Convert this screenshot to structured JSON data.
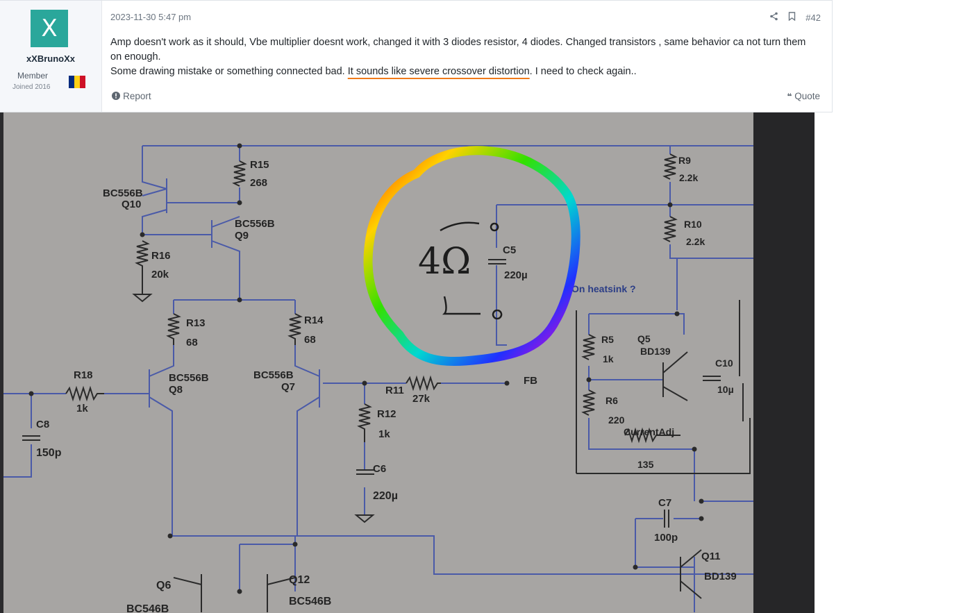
{
  "post": {
    "user": {
      "avatar_letter": "X",
      "name": "xXBrunoXx",
      "role": "Member",
      "joined": "Joined 2016",
      "flag_colors": [
        "#002b7f",
        "#fcd116",
        "#ce1126"
      ],
      "avatar_color": "#2aa79b"
    },
    "date": "2023-11-30 5:47 pm",
    "post_number": "#42",
    "icons": {
      "share": "share-icon",
      "bookmark": "bookmark-icon",
      "report": "alert-icon",
      "quote": "quote-icon"
    },
    "text": {
      "line1": "Amp doesn't work as it should, Vbe multiplier doesnt work, changed it with 3 diodes resistor, 4 diodes. Changed transistors , same behavior ca not turn them on enough.",
      "line2_before": "Some drawing mistake or something connected bad. ",
      "line2_highlight": "It sounds like severe crossover distortion",
      "line2_after": ". I need to check again.."
    },
    "report_label": "Report",
    "quote_label": "Quote",
    "highlight_color": "#f07a1a"
  },
  "schematic": {
    "labels": {
      "q10_type": "BC556B",
      "q10": "Q10",
      "r15": "R15",
      "r15_val": "268",
      "q9_type": "BC556B",
      "q9": "Q9",
      "r16": "R16",
      "r16_val": "20k",
      "r13": "R13",
      "r13_val": "68",
      "r14": "R14",
      "r14_val": "68",
      "r18": "R18",
      "r18_val": "1k",
      "q8_type": "BC556B",
      "q8": "Q8",
      "q7_type": "BC556B",
      "q7": "Q7",
      "r11": "R11",
      "r11_val": "27k",
      "fb": "FB",
      "r12": "R12",
      "r12_val": "1k",
      "c8": "C8",
      "c8_val": "150p",
      "c6": "C6",
      "c6_val": "220µ",
      "c5": "C5",
      "c5_val": "220µ",
      "r9": "R9",
      "r9_val": "2.2k",
      "r10": "R10",
      "r10_val": "2.2k",
      "heatsink": "On heatsink ?",
      "r5": "R5",
      "r5_val": "1k",
      "q5": "Q5",
      "q5_type": "BD139",
      "c10": "C10",
      "c10_val": "10µ",
      "r6": "R6",
      "r6_val": "220",
      "current_adj": "CurrentAdj",
      "current_adj_val": "135",
      "c7": "C7",
      "c7_val": "100p",
      "q11": "Q11",
      "q11_type": "BD139",
      "q6": "Q6",
      "q6_type": "BC546B",
      "q12": "Q12",
      "q12_type": "BC546B",
      "handwritten_load": "4Ω"
    }
  }
}
